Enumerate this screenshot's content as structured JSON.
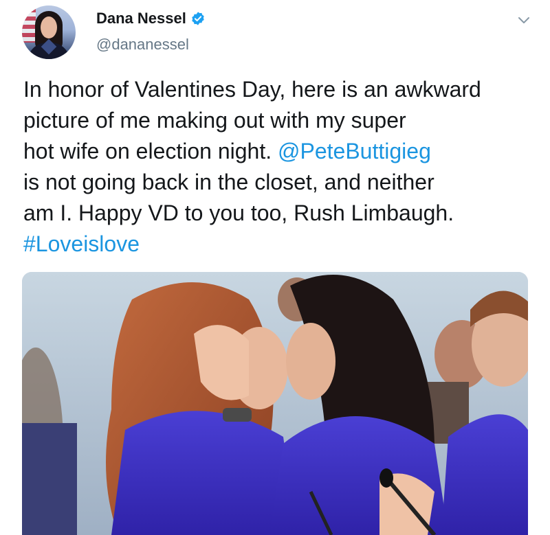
{
  "tweet": {
    "author": {
      "display_name": "Dana Nessel",
      "handle": "@dananessel",
      "verified": true,
      "avatar_icon": "profile-photo"
    },
    "text_lines": [
      [
        {
          "text": "In honor of Valentines Day, here is an awkward",
          "type": "plain"
        }
      ],
      [
        {
          "text": "picture of me making out with my super",
          "type": "plain"
        }
      ],
      [
        {
          "text": "hot wife on election night. ",
          "type": "plain"
        },
        {
          "text": "@PeteButtigieg",
          "type": "mention"
        }
      ],
      [
        {
          "text": "is not going back in the closet, and neither",
          "type": "plain"
        }
      ],
      [
        {
          "text": "am I. Happy VD to you too, Rush Limbaugh.",
          "type": "plain"
        }
      ],
      [
        {
          "text": "#Loveislove",
          "type": "hashtag"
        }
      ]
    ],
    "media": {
      "type": "photo"
    }
  },
  "colors": {
    "link": "#1b95e0",
    "handle": "#657786",
    "verified_badge": "#1da1f2",
    "text": "#14171a"
  },
  "icons": {
    "verified": "verified-badge-icon",
    "menu": "chevron-down-icon"
  }
}
